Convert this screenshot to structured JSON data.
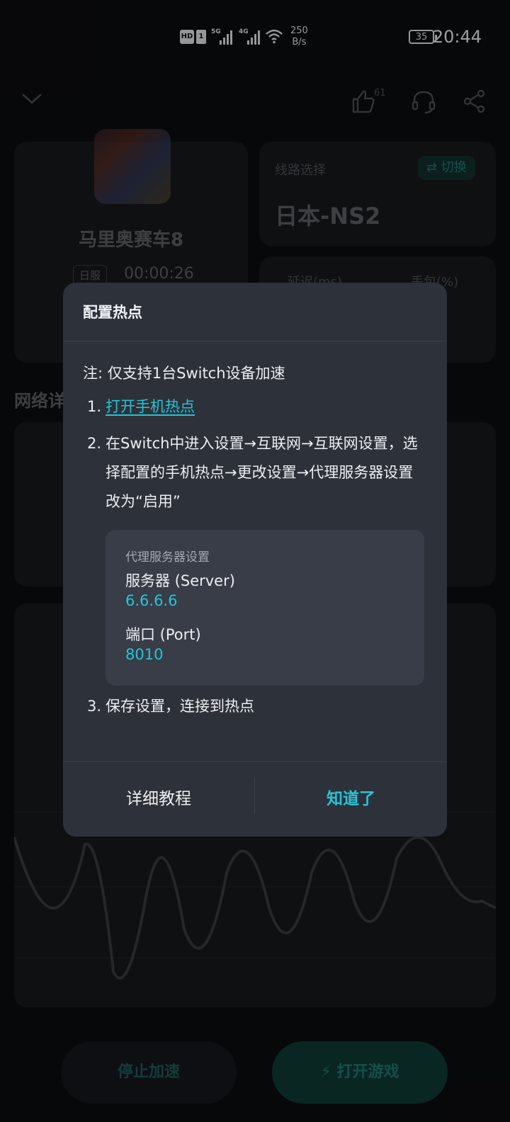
{
  "status_bar": {
    "time": "20:44",
    "battery": "35",
    "speed_value": "250",
    "speed_unit": "B/s",
    "hd_label": "HD",
    "sim_label": "1",
    "net1": "5G",
    "net2": "4G"
  },
  "header": {
    "like_count": "61"
  },
  "game": {
    "name": "马里奥赛车8",
    "server_tag": "日服",
    "timer": "00:00:26"
  },
  "route": {
    "label": "线路选择",
    "switch_label": "⇄ 切换",
    "value": "日本-NS2"
  },
  "stats": {
    "latency_label": "延迟(ms)",
    "loss_label": "丢包(%)"
  },
  "network_section_title": "网络详情",
  "bottom": {
    "stop_label": "停止加速",
    "open_label": "打开游戏"
  },
  "modal": {
    "title": "配置热点",
    "note": "注: 仅支持1台Switch设备加速",
    "steps": [
      {
        "num": "1.",
        "text": "打开手机热点"
      },
      {
        "num": "2.",
        "text": "在Switch中进入设置→互联网→互联网设置，选择配置的手机热点→更改设置→代理服务器设置改为“启用”"
      },
      {
        "num": "3.",
        "text": "保存设置，连接到热点"
      }
    ],
    "proxy": {
      "title": "代理服务器设置",
      "server_label": "服务器 (Server)",
      "server_value": "6.6.6.6",
      "port_label": "端口 (Port)",
      "port_value": "8010"
    },
    "detail_button": "详细教程",
    "ok_button": "知道了"
  },
  "colors": {
    "accent": "#27c4d6",
    "modal_bg": "#2d3139",
    "proxy_bg": "#383d47",
    "page_bg": "#0c0d10"
  }
}
